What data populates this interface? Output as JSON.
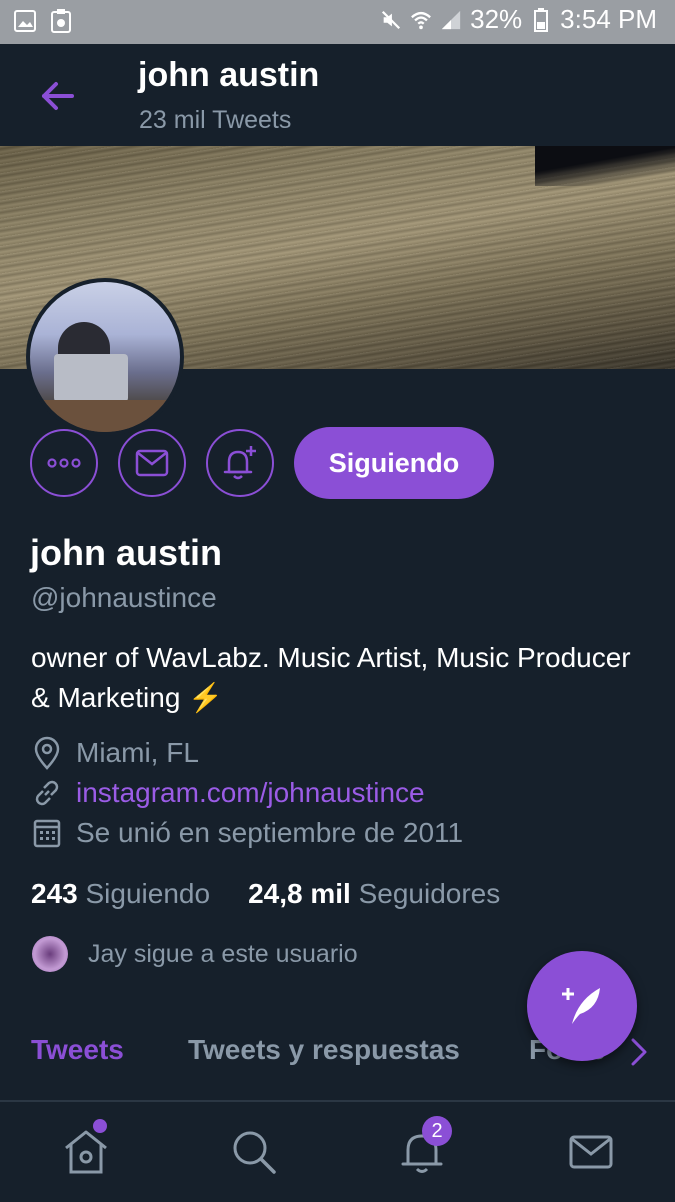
{
  "status_bar": {
    "battery_percent": "32%",
    "time": "3:54 PM",
    "left_icons": [
      "gallery-icon",
      "clipboard-icon"
    ],
    "right_icons": [
      "mute-icon",
      "wifi-icon",
      "signal-icon",
      "battery-icon"
    ]
  },
  "header": {
    "title": "john austin",
    "subtitle": "23 mil Tweets",
    "back_icon": "back-arrow-icon"
  },
  "profile": {
    "follow_label": "Siguiendo",
    "name": "john austin",
    "handle": "@johnaustince",
    "bio": "owner of WavLabz. Music Artist, Music Producer & Marketing ⚡",
    "location": "Miami, FL",
    "website": "instagram.com/johnaustince",
    "joined": "Se unió en septiembre de 2011",
    "following_count": "243",
    "following_label": "Siguiendo",
    "followers_count": "24,8 mil",
    "followers_label": "Seguidores",
    "followed_by": "Jay sigue a este usuario"
  },
  "actions": {
    "icons": [
      "more-icon",
      "message-icon",
      "notify-icon"
    ]
  },
  "tabs": [
    {
      "label": "Tweets"
    },
    {
      "label": "Tweets y respuestas"
    },
    {
      "label": "Fotos"
    }
  ],
  "bottom_nav": {
    "notifications_badge": "2",
    "items": [
      "home-icon",
      "search-icon",
      "bell-icon",
      "mail-icon"
    ]
  },
  "colors": {
    "accent": "#8b4fd6",
    "background": "#16202b",
    "muted": "#8a99a8"
  }
}
